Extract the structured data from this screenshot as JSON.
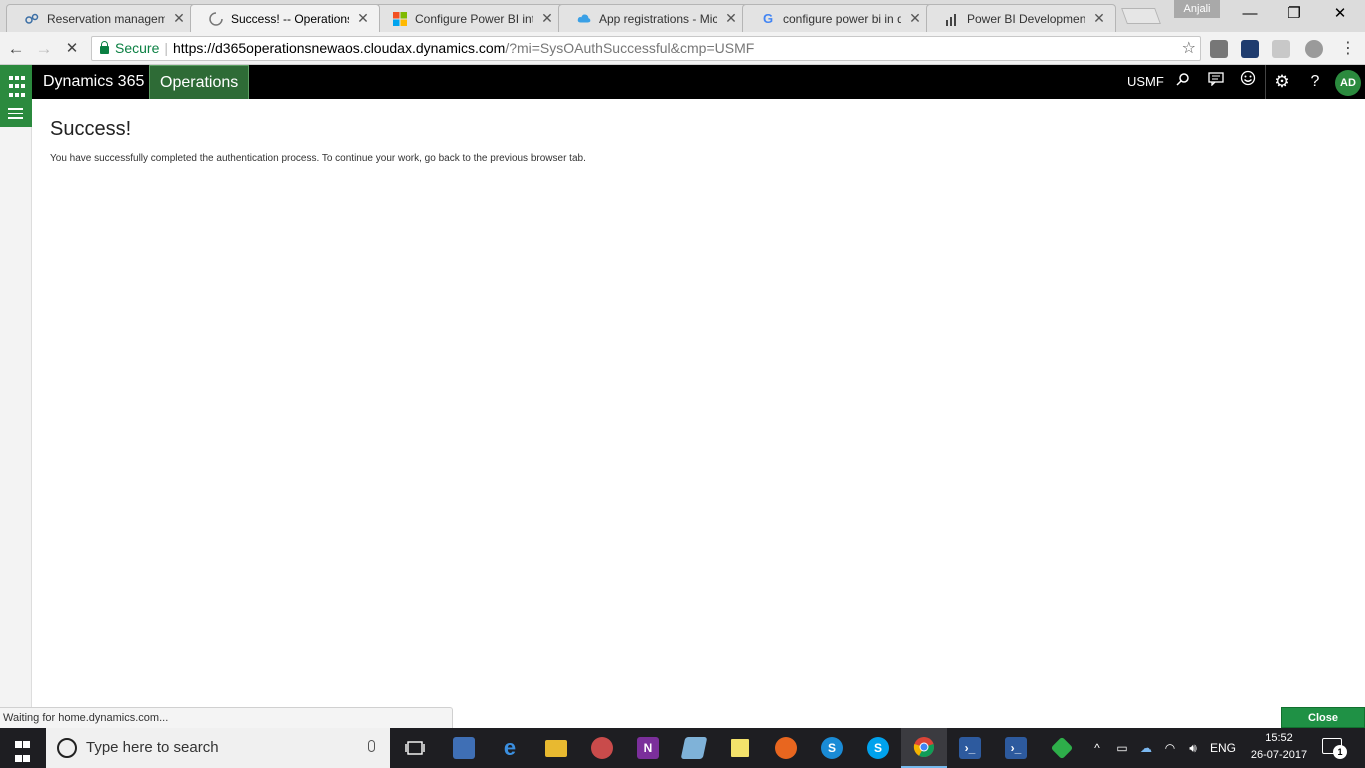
{
  "browser": {
    "tabs": [
      {
        "title": "Reservation manageme",
        "icon": "network-icon"
      },
      {
        "title": "Success! -- Operations",
        "icon": "loading-icon"
      },
      {
        "title": "Configure Power BI inte",
        "icon": "microsoft-icon"
      },
      {
        "title": "App registrations - Mic",
        "icon": "cloud-icon"
      },
      {
        "title": "configure power bi in d",
        "icon": "google-icon"
      },
      {
        "title": "Power BI Development",
        "icon": "bar-chart-icon"
      }
    ],
    "active_tab_index": 1,
    "profile_name": "Anjali",
    "secure_label": "Secure",
    "url_host": "https://d365operationsnewaos.cloudax.dynamics.com",
    "url_rest": "/?mi=SysOAuthSuccessful&cmp=USMF",
    "status_text": "Waiting for home.dynamics.com...",
    "close_label": "Close"
  },
  "app": {
    "brand": "Dynamics 365",
    "module": "Operations",
    "company": "USMF",
    "avatar_initials": "AD",
    "accent_color": "#2b8a3e"
  },
  "page": {
    "title": "Success!",
    "message": "You have successfully completed the authentication process. To continue your work, go back to the previous browser tab."
  },
  "taskbar": {
    "search_placeholder": "Type here to search",
    "language": "ENG",
    "time": "15:52",
    "date": "26-07-2017",
    "notification_count": "1"
  }
}
